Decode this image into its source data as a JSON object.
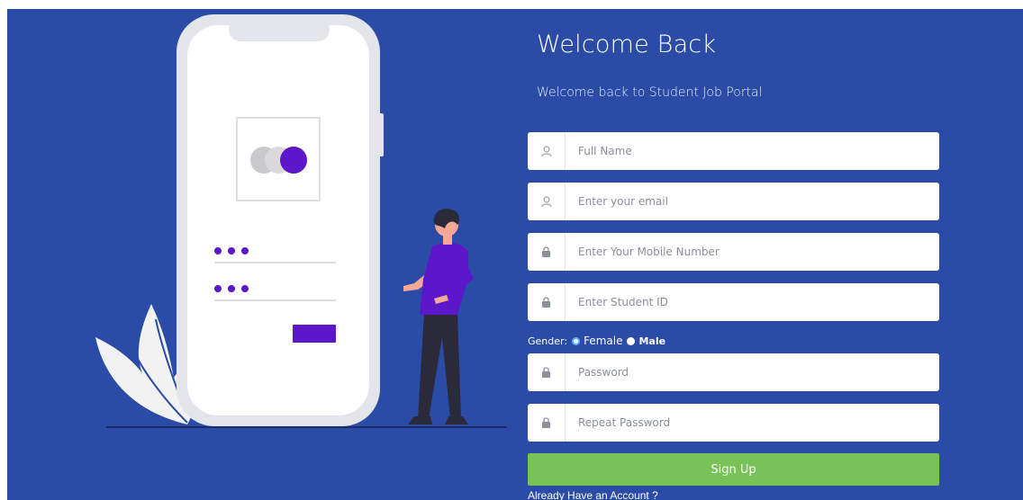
{
  "header": {
    "title": "Welcome Back",
    "subtitle": "Welcome back to Student Job Portal"
  },
  "form": {
    "fields": [
      {
        "name": "full-name",
        "placeholder": "Full Name",
        "icon": "user-icon",
        "value": ""
      },
      {
        "name": "email",
        "placeholder": "Enter your email",
        "icon": "user-icon",
        "value": ""
      },
      {
        "name": "mobile",
        "placeholder": "Enter Your Mobile Number",
        "icon": "lock-icon",
        "value": ""
      },
      {
        "name": "student-id",
        "placeholder": "Enter Student ID",
        "icon": "lock-icon",
        "value": ""
      },
      {
        "name": "password",
        "placeholder": "Password",
        "icon": "lock-icon",
        "value": ""
      },
      {
        "name": "repeat-password",
        "placeholder": "Repeat Password",
        "icon": "lock-icon",
        "value": ""
      }
    ],
    "gender": {
      "label": "Gender:",
      "options": [
        "Female",
        "Male"
      ],
      "selected": "Female"
    },
    "submit_label": "Sign Up",
    "login_link": "Already Have an Account ?"
  },
  "colors": {
    "background": "#2b4ca6",
    "accent": "#5b17c9",
    "button": "#78c257"
  }
}
